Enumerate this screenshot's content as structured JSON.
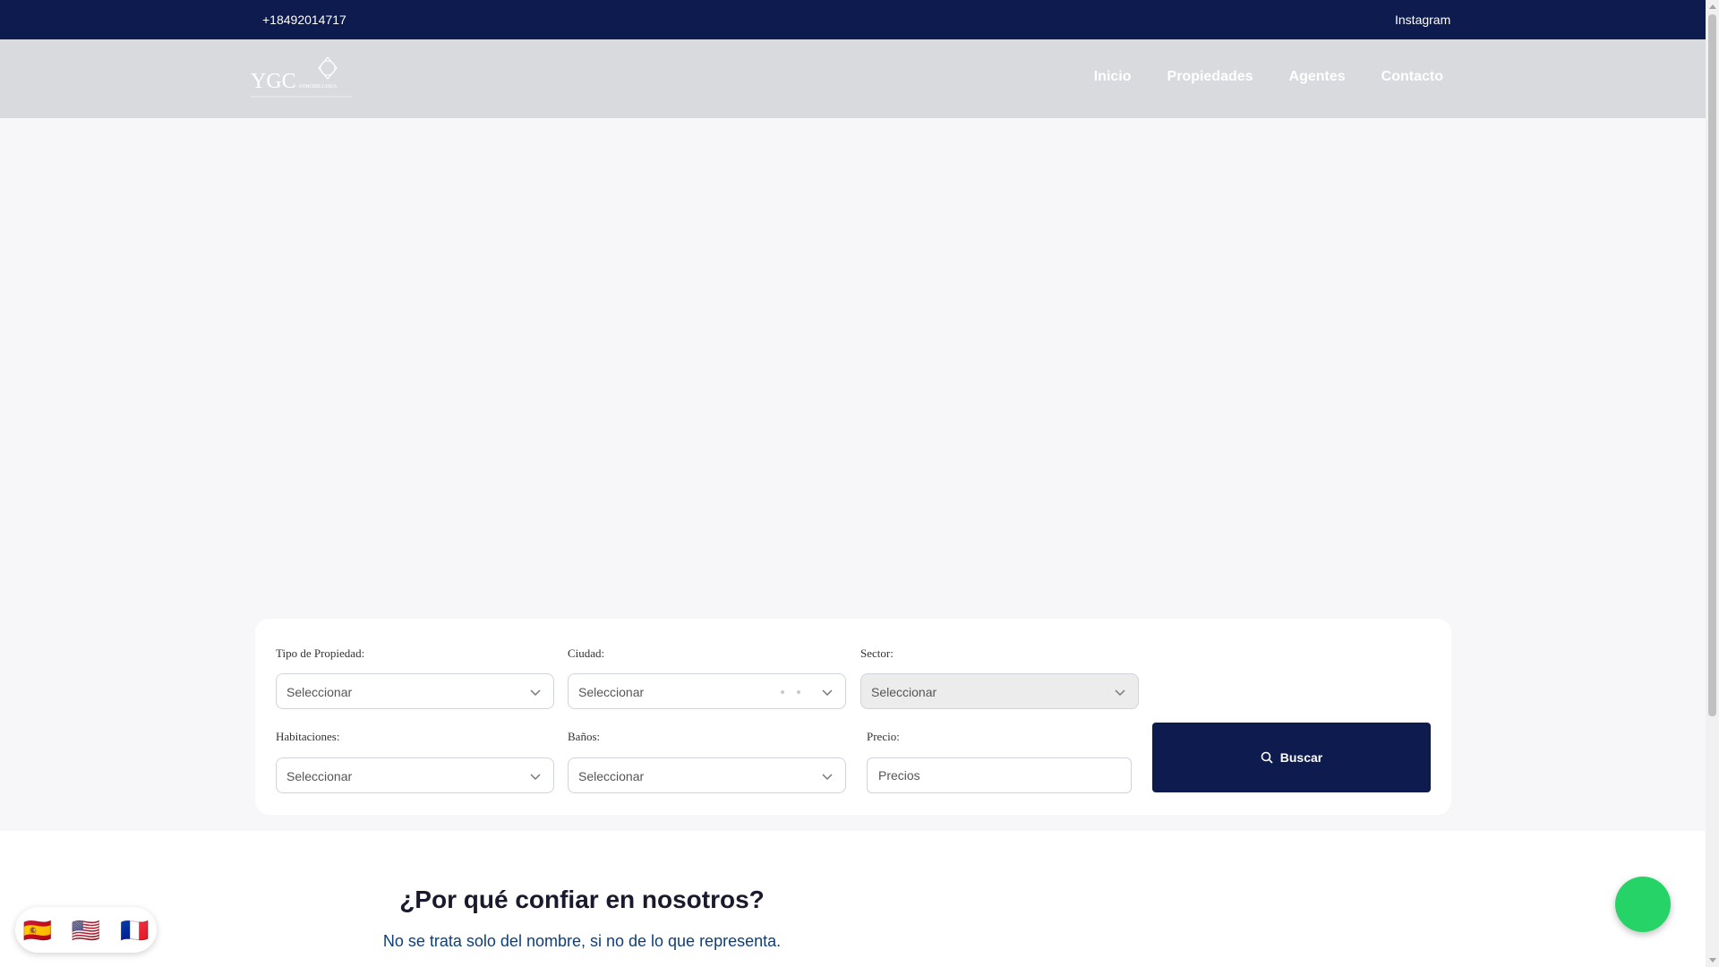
{
  "topbar": {
    "phone": "+18492014717",
    "social": "Instagram"
  },
  "brand": {
    "logo_text": "YGC",
    "logo_subtext": "INMOBILIARIA"
  },
  "nav": {
    "items": [
      "Inicio",
      "Propiedades",
      "Agentes",
      "Contacto"
    ]
  },
  "search": {
    "tipo_label": "Tipo de Propiedad:",
    "tipo_value": "Seleccionar",
    "ciudad_label": "Ciudad:",
    "ciudad_value": "Seleccionar",
    "sector_label": "Sector:",
    "sector_value": "Seleccionar",
    "habitaciones_label": "Habitaciones:",
    "habitaciones_value": "Seleccionar",
    "banos_label": "Baños:",
    "banos_value": "Seleccionar",
    "precio_label": "Precio:",
    "precio_placeholder": "Precios",
    "button_label": "Buscar"
  },
  "trust": {
    "title": "¿Por qué confiar en nosotros?",
    "subtitle": "No se trata solo del nombre, si no de lo que representa."
  },
  "languages": [
    {
      "name": "spanish-flag",
      "glyph": "🇪🇸"
    },
    {
      "name": "us-flag",
      "glyph": "🇺🇸"
    },
    {
      "name": "french-flag",
      "glyph": "🇫🇷"
    }
  ],
  "colors": {
    "navy": "#0d1b4e",
    "navbar_bg": "#d9dade",
    "whatsapp": "#25d366"
  },
  "icons": {
    "search": "search-icon",
    "chevron": "chevron-down-icon",
    "whatsapp": "whatsapp-icon"
  }
}
